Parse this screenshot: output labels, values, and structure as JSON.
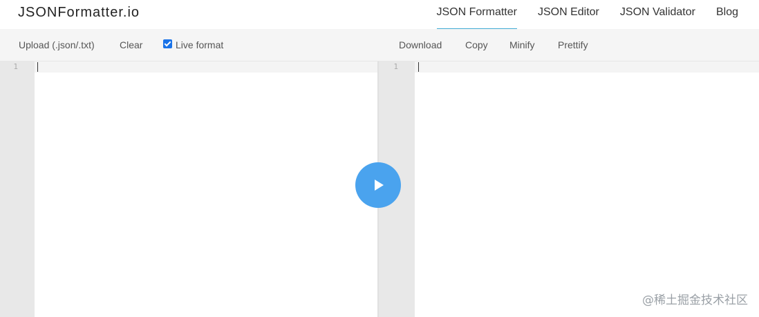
{
  "header": {
    "logo": "JSONFormatter.io",
    "nav": [
      {
        "label": "JSON Formatter",
        "active": true
      },
      {
        "label": "JSON Editor"
      },
      {
        "label": "JSON Validator"
      },
      {
        "label": "Blog"
      }
    ]
  },
  "toolbar": {
    "left": {
      "upload": "Upload (.json/.txt)",
      "clear": "Clear",
      "live_format": "Live format",
      "live_format_checked": true
    },
    "right": {
      "download": "Download",
      "copy": "Copy",
      "minify": "Minify",
      "prettify": "Prettify"
    }
  },
  "editors": {
    "input": {
      "line_number": "1",
      "content": ""
    },
    "output": {
      "line_number": "1",
      "content": ""
    }
  },
  "play_button": {
    "icon": "play-icon"
  },
  "watermark": "@稀土掘金技术社区",
  "colors": {
    "accent": "#3ea9d3",
    "play": "#4aa3ee",
    "checkbox": "#1a73e8"
  }
}
